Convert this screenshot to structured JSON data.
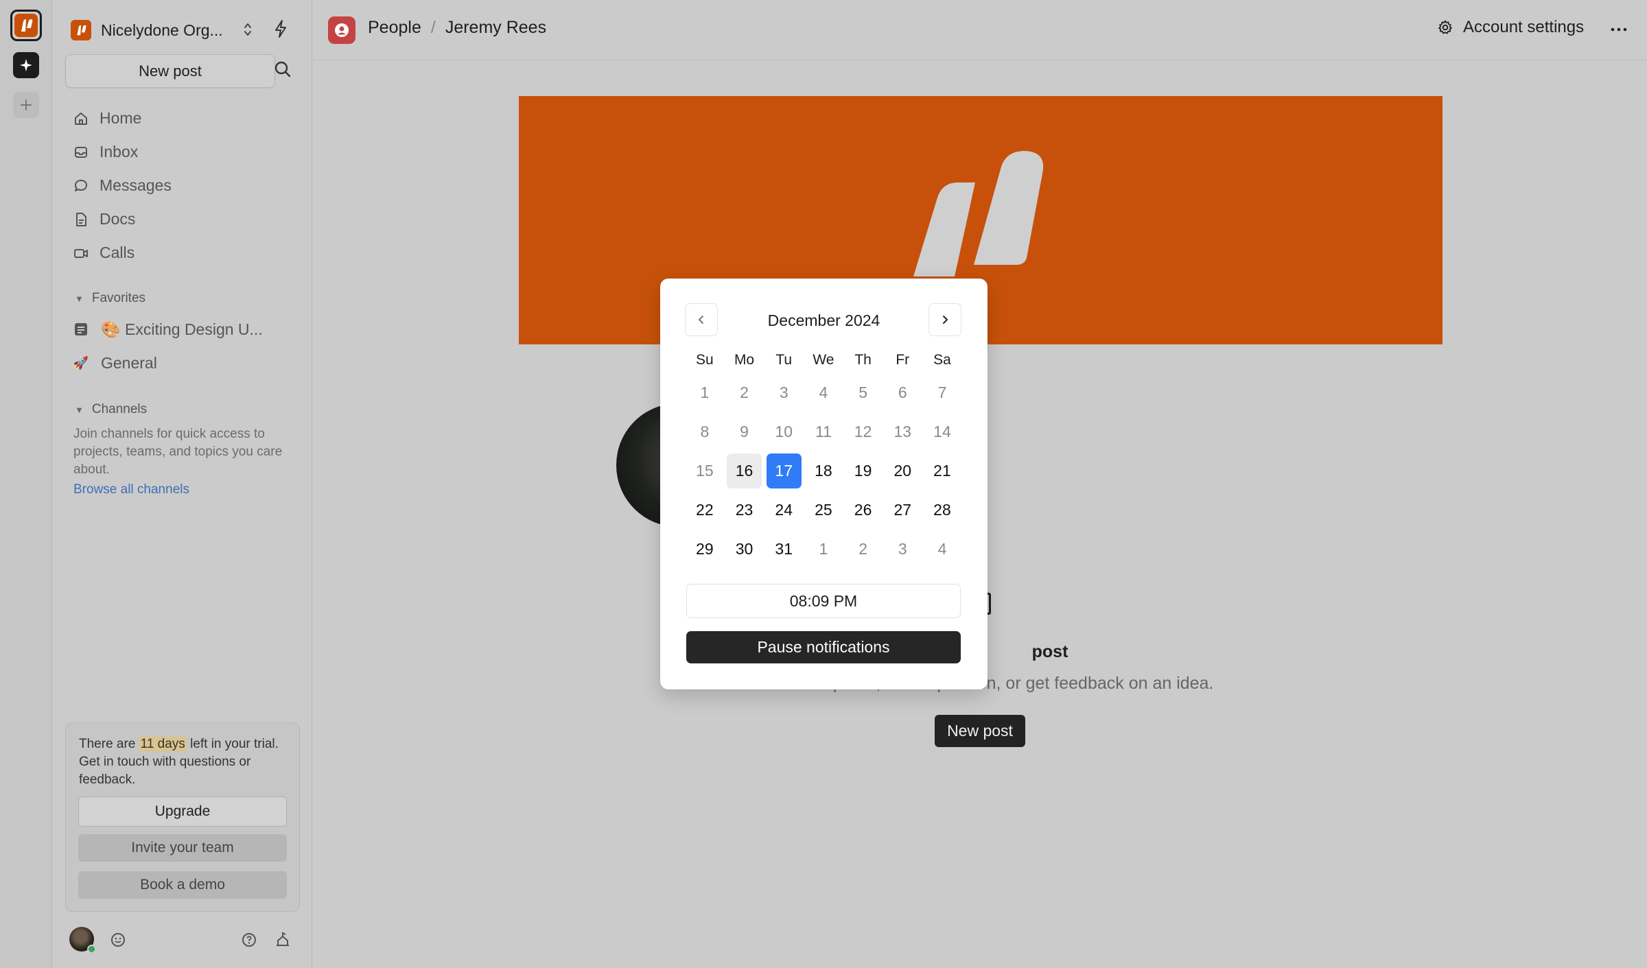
{
  "org": {
    "name": "Nicelydone Org...",
    "accent": "#c7510a"
  },
  "sidebar": {
    "new_post_label": "New post",
    "nav": [
      {
        "label": "Home",
        "icon": "home-icon"
      },
      {
        "label": "Inbox",
        "icon": "inbox-icon"
      },
      {
        "label": "Messages",
        "icon": "messages-icon"
      },
      {
        "label": "Docs",
        "icon": "docs-icon"
      },
      {
        "label": "Calls",
        "icon": "calls-icon"
      }
    ],
    "favorites_heading": "Favorites",
    "favorites": [
      {
        "label": "🎨 Exciting Design U...",
        "icon": "doc-icon"
      },
      {
        "label": "General",
        "icon": "rocket-icon"
      }
    ],
    "channels_heading": "Channels",
    "channels_description": "Join channels for quick access to projects, teams, and topics you care about.",
    "browse_channels_label": "Browse all channels",
    "trial": {
      "text_before": "There are ",
      "highlight": "11 days",
      "text_after": " left in your trial. Get in touch with questions or feedback.",
      "upgrade_label": "Upgrade",
      "invite_label": "Invite your team",
      "demo_label": "Book a demo"
    }
  },
  "header": {
    "breadcrumb_section": "People",
    "breadcrumb_separator": "/",
    "breadcrumb_page": "Jeremy Rees",
    "account_settings_label": "Account settings"
  },
  "main": {
    "empty_title": "post",
    "empty_subtitle": "Share an update, ask a question, or get feedback on an idea.",
    "new_post_label": "New post",
    "cover_color": "#c7510a"
  },
  "date_picker": {
    "month_label": "December 2024",
    "weekdays": [
      "Su",
      "Mo",
      "Tu",
      "We",
      "Th",
      "Fr",
      "Sa"
    ],
    "weeks": [
      [
        "1",
        "2",
        "3",
        "4",
        "5",
        "6",
        "7"
      ],
      [
        "8",
        "9",
        "10",
        "11",
        "12",
        "13",
        "14"
      ],
      [
        "15",
        "16",
        "17",
        "18",
        "19",
        "20",
        "21"
      ],
      [
        "22",
        "23",
        "24",
        "25",
        "26",
        "27",
        "28"
      ],
      [
        "29",
        "30",
        "31",
        "1",
        "2",
        "3",
        "4"
      ]
    ],
    "today": "16",
    "selected": "17",
    "time_value": "08:09 PM",
    "pause_label": "Pause notifications",
    "selected_color": "#2f7cf6"
  }
}
